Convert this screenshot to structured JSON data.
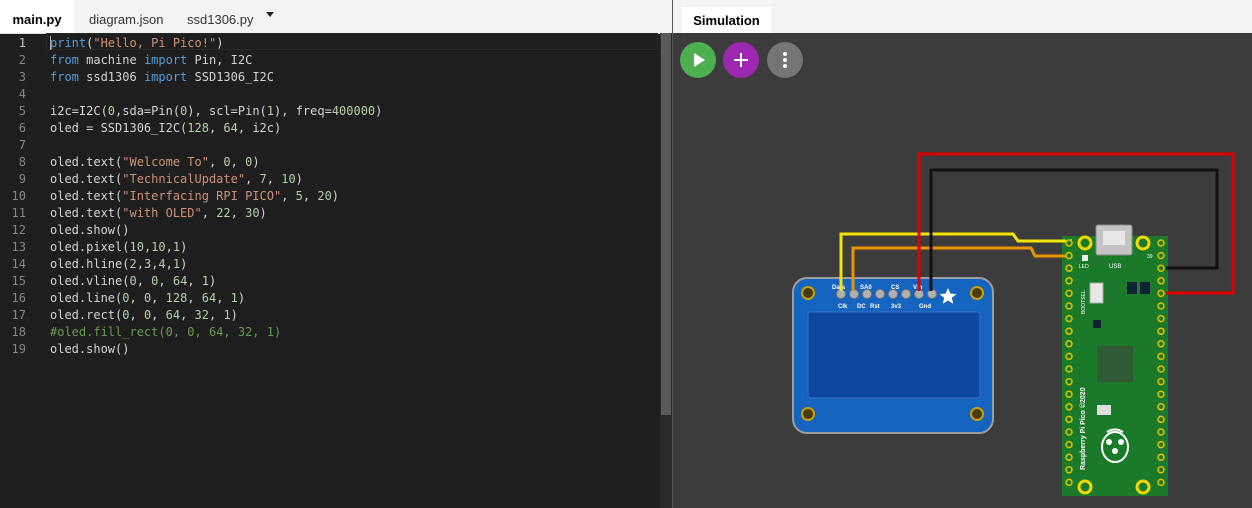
{
  "editor": {
    "tabs": [
      {
        "label": "main.py",
        "active": true
      },
      {
        "label": "diagram.json",
        "active": false
      },
      {
        "label": "ssd1306.py",
        "active": false
      }
    ],
    "line_numbers": [
      "1",
      "2",
      "3",
      "4",
      "5",
      "6",
      "7",
      "8",
      "9",
      "10",
      "11",
      "12",
      "13",
      "14",
      "15",
      "16",
      "17",
      "18",
      "19"
    ],
    "code": [
      [
        {
          "t": "k",
          "v": "print"
        },
        {
          "t": "d",
          "v": "("
        },
        {
          "t": "s",
          "v": "\"Hello, Pi Pico!\""
        },
        {
          "t": "d",
          "v": ")"
        }
      ],
      [
        {
          "t": "k",
          "v": "from"
        },
        {
          "t": "d",
          "v": " machine "
        },
        {
          "t": "k",
          "v": "import"
        },
        {
          "t": "d",
          "v": " Pin, I2C"
        }
      ],
      [
        {
          "t": "k",
          "v": "from"
        },
        {
          "t": "d",
          "v": " ssd1306 "
        },
        {
          "t": "k",
          "v": "import"
        },
        {
          "t": "d",
          "v": " SSD1306_I2C"
        }
      ],
      [],
      [
        {
          "t": "d",
          "v": "i2c=I2C("
        },
        {
          "t": "n",
          "v": "0"
        },
        {
          "t": "d",
          "v": ",sda=Pin("
        },
        {
          "t": "n",
          "v": "0"
        },
        {
          "t": "d",
          "v": "), scl=Pin("
        },
        {
          "t": "n",
          "v": "1"
        },
        {
          "t": "d",
          "v": "), freq="
        },
        {
          "t": "n",
          "v": "400000"
        },
        {
          "t": "d",
          "v": ")"
        }
      ],
      [
        {
          "t": "d",
          "v": "oled = SSD1306_I2C("
        },
        {
          "t": "n",
          "v": "128"
        },
        {
          "t": "d",
          "v": ", "
        },
        {
          "t": "n",
          "v": "64"
        },
        {
          "t": "d",
          "v": ", i2c)"
        }
      ],
      [],
      [
        {
          "t": "d",
          "v": "oled.text("
        },
        {
          "t": "s",
          "v": "\"Welcome To\""
        },
        {
          "t": "d",
          "v": ", "
        },
        {
          "t": "n",
          "v": "0"
        },
        {
          "t": "d",
          "v": ", "
        },
        {
          "t": "n",
          "v": "0"
        },
        {
          "t": "d",
          "v": ")"
        }
      ],
      [
        {
          "t": "d",
          "v": "oled.text("
        },
        {
          "t": "s",
          "v": "\"TechnicalUpdate\""
        },
        {
          "t": "d",
          "v": ", "
        },
        {
          "t": "n",
          "v": "7"
        },
        {
          "t": "d",
          "v": ", "
        },
        {
          "t": "n",
          "v": "10"
        },
        {
          "t": "d",
          "v": ")"
        }
      ],
      [
        {
          "t": "d",
          "v": "oled.text("
        },
        {
          "t": "s",
          "v": "\"Interfacing RPI PICO\""
        },
        {
          "t": "d",
          "v": ", "
        },
        {
          "t": "n",
          "v": "5"
        },
        {
          "t": "d",
          "v": ", "
        },
        {
          "t": "n",
          "v": "20"
        },
        {
          "t": "d",
          "v": ")"
        }
      ],
      [
        {
          "t": "d",
          "v": "oled.text("
        },
        {
          "t": "s",
          "v": "\"with OLED\""
        },
        {
          "t": "d",
          "v": ", "
        },
        {
          "t": "n",
          "v": "22"
        },
        {
          "t": "d",
          "v": ", "
        },
        {
          "t": "n",
          "v": "30"
        },
        {
          "t": "d",
          "v": ")"
        }
      ],
      [
        {
          "t": "d",
          "v": "oled.show()"
        }
      ],
      [
        {
          "t": "d",
          "v": "oled.pixel("
        },
        {
          "t": "n",
          "v": "10"
        },
        {
          "t": "d",
          "v": ","
        },
        {
          "t": "n",
          "v": "10"
        },
        {
          "t": "d",
          "v": ","
        },
        {
          "t": "n",
          "v": "1"
        },
        {
          "t": "d",
          "v": ")"
        }
      ],
      [
        {
          "t": "d",
          "v": "oled.hline("
        },
        {
          "t": "n",
          "v": "2"
        },
        {
          "t": "d",
          "v": ","
        },
        {
          "t": "n",
          "v": "3"
        },
        {
          "t": "d",
          "v": ","
        },
        {
          "t": "n",
          "v": "4"
        },
        {
          "t": "d",
          "v": ","
        },
        {
          "t": "n",
          "v": "1"
        },
        {
          "t": "d",
          "v": ")"
        }
      ],
      [
        {
          "t": "d",
          "v": "oled.vline("
        },
        {
          "t": "n",
          "v": "0"
        },
        {
          "t": "d",
          "v": ", "
        },
        {
          "t": "n",
          "v": "0"
        },
        {
          "t": "d",
          "v": ", "
        },
        {
          "t": "n",
          "v": "64"
        },
        {
          "t": "d",
          "v": ", "
        },
        {
          "t": "n",
          "v": "1"
        },
        {
          "t": "d",
          "v": ")"
        }
      ],
      [
        {
          "t": "d",
          "v": "oled.line("
        },
        {
          "t": "n",
          "v": "0"
        },
        {
          "t": "d",
          "v": ", "
        },
        {
          "t": "n",
          "v": "0"
        },
        {
          "t": "d",
          "v": ", "
        },
        {
          "t": "n",
          "v": "128"
        },
        {
          "t": "d",
          "v": ", "
        },
        {
          "t": "n",
          "v": "64"
        },
        {
          "t": "d",
          "v": ", "
        },
        {
          "t": "n",
          "v": "1"
        },
        {
          "t": "d",
          "v": ")"
        }
      ],
      [
        {
          "t": "d",
          "v": "oled.rect("
        },
        {
          "t": "n",
          "v": "0"
        },
        {
          "t": "d",
          "v": ", "
        },
        {
          "t": "n",
          "v": "0"
        },
        {
          "t": "d",
          "v": ", "
        },
        {
          "t": "n",
          "v": "64"
        },
        {
          "t": "d",
          "v": ", "
        },
        {
          "t": "n",
          "v": "32"
        },
        {
          "t": "d",
          "v": ", "
        },
        {
          "t": "n",
          "v": "1"
        },
        {
          "t": "d",
          "v": ")"
        }
      ],
      [
        {
          "t": "c",
          "v": "#oled.fill_rect(0, 0, 64, 32, 1)"
        }
      ],
      [
        {
          "t": "d",
          "v": "oled.show()"
        }
      ]
    ],
    "syntax_colors": {
      "keyword": "#569cd6",
      "string": "#ce9178",
      "number": "#b5cea8",
      "comment": "#6a9955",
      "default": "#d4d4d4"
    }
  },
  "simulation": {
    "tab_label": "Simulation",
    "buttons": [
      {
        "name": "start-simulation-button",
        "icon": "play-icon",
        "color": "#4caf50"
      },
      {
        "name": "add-part-button",
        "icon": "plus-icon",
        "color": "#9c27b0"
      },
      {
        "name": "more-options-button",
        "icon": "dots-vertical-icon",
        "color": "#757575"
      }
    ],
    "oled": {
      "top_labels": [
        "Data",
        "SA0",
        "CS",
        "Vin"
      ],
      "bottom_labels": [
        "Clk",
        "DC",
        "Rst",
        "3v3",
        "Gnd"
      ],
      "board_color": "#1565c0",
      "screen_color": "#0d47a1"
    },
    "pico": {
      "board_label": "Raspberry Pi Pico ©2020",
      "usb_label": "USB",
      "led_label": "LED",
      "bootsel_label": "BOOTSEL",
      "pin_left_top": "1",
      "pin_left_second": "2",
      "pin_right_top": "39",
      "board_color": "#1b7a2a"
    },
    "wire_colors": {
      "data": "#f5e400",
      "clk": "#e69500",
      "vin": "#e00000",
      "gnd": "#111111"
    }
  }
}
